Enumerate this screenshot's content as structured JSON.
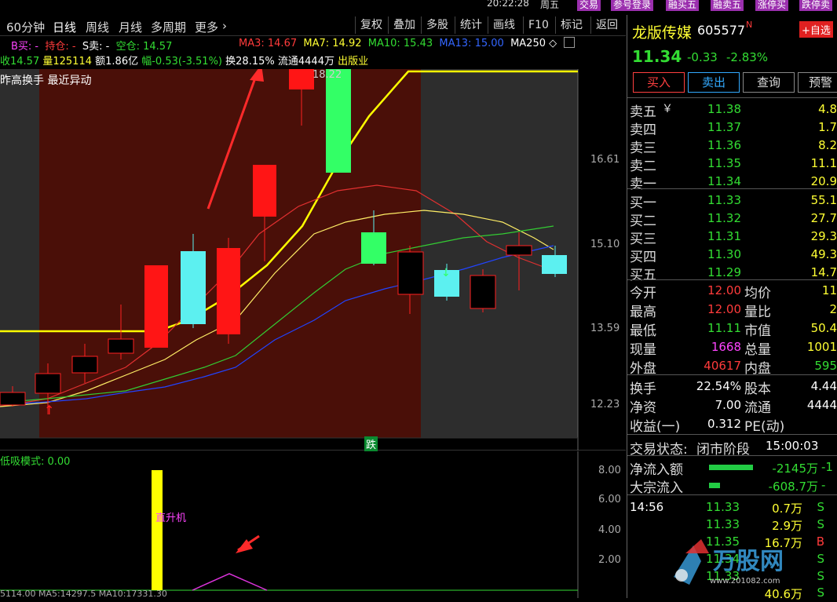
{
  "topbar": {
    "time": "20:22:28",
    "weekday": "周五",
    "buttons": [
      "交易",
      "参号登录",
      "融买五",
      "融卖五",
      "涨停买",
      "跌停卖"
    ]
  },
  "toolbar": {
    "tabs": [
      "60分钟",
      "日线",
      "周线",
      "月线",
      "多周期",
      "更多"
    ],
    "active_tab": "日线",
    "right_buttons": [
      "复权",
      "叠加",
      "多股",
      "统计",
      "画线",
      "F10",
      "标记",
      "返回"
    ]
  },
  "info1": {
    "b_buy": "B买: -",
    "position": "持仓: -",
    "s_sell": "S卖: -",
    "empty_position": "空仓: 14.57",
    "ma3": "MA3: 14.67",
    "ma7": "MA7: 14.92",
    "ma10": "MA10: 15.43",
    "ma13": "MA13: 15.00",
    "ma250": "MA250"
  },
  "info2": {
    "close": "收14.57",
    "volume": "量125114",
    "amount": "额1.86亿",
    "change": "幅-0.53(-3.51%)",
    "turnover": "换28.15%",
    "float": "流通4444万",
    "industry": "出版业"
  },
  "chart_overlay": {
    "notice": "昨高换手 最近异动",
    "high_label": "18.22",
    "drop_badge": "跌"
  },
  "y_axis_main": [
    "16.61",
    "15.10",
    "13.59",
    "12.23"
  ],
  "indicator": {
    "title": "低吸模式: 0.00",
    "bar_label": "直升机",
    "y_axis": [
      "8.00",
      "6.00",
      "4.00",
      "2.00"
    ],
    "bottom_text": "5114.00  MA5:14297.5  MA10:17331.30"
  },
  "stock": {
    "name": "龙版传媒",
    "code": "605577",
    "flag": "N",
    "add_watch": "+自选",
    "price": "11.34",
    "change": "-0.33",
    "change_pct": "-2.83%"
  },
  "actions": [
    "买入",
    "卖出",
    "查询",
    "预警"
  ],
  "sell_orders": [
    {
      "label": "卖五",
      "price": "11.38",
      "vol": "4.8"
    },
    {
      "label": "卖四",
      "price": "11.37",
      "vol": "1.7"
    },
    {
      "label": "卖三",
      "price": "11.36",
      "vol": "8.2"
    },
    {
      "label": "卖二",
      "price": "11.35",
      "vol": "11.1"
    },
    {
      "label": "卖一",
      "price": "11.34",
      "vol": "20.9"
    }
  ],
  "buy_orders": [
    {
      "label": "买一",
      "price": "11.33",
      "vol": "55.1"
    },
    {
      "label": "买二",
      "price": "11.32",
      "vol": "27.7"
    },
    {
      "label": "买三",
      "price": "11.31",
      "vol": "29.3"
    },
    {
      "label": "买四",
      "price": "11.30",
      "vol": "49.3"
    },
    {
      "label": "买五",
      "price": "11.29",
      "vol": "14.7"
    }
  ],
  "quotes": [
    {
      "l1": "今开",
      "v1": "12.00",
      "l2": "均价",
      "v2": "11"
    },
    {
      "l1": "最高",
      "v1": "12.00",
      "l2": "量比",
      "v2": "2"
    },
    {
      "l1": "最低",
      "v1": "11.11",
      "l2": "市值",
      "v2": "50.4"
    },
    {
      "l1": "现量",
      "v1": "1668",
      "l2": "总量",
      "v2": "1001"
    },
    {
      "l1": "外盘",
      "v1": "40617",
      "l2": "内盘",
      "v2": "595"
    }
  ],
  "fundamentals": [
    {
      "l1": "换手",
      "v1": "22.54%",
      "l2": "股本",
      "v2": "4.44"
    },
    {
      "l1": "净资",
      "v1": "7.00",
      "l2": "流通",
      "v2": "4444"
    },
    {
      "l1": "收益(一)",
      "v1": "0.312",
      "l2": "PE(动)",
      "v2": ""
    }
  ],
  "trade_status": {
    "label": "交易状态:",
    "value": "闭市阶段",
    "time": "15:00:03"
  },
  "flows": [
    {
      "label": "净流入额",
      "value": "-2145万",
      "tail": "-1"
    },
    {
      "label": "大宗流入",
      "value": "-608.7万",
      "tail": "-"
    }
  ],
  "ticks": [
    {
      "time": "14:56",
      "price": "11.33",
      "vol": "0.7万",
      "side": "S"
    },
    {
      "time": "",
      "price": "11.33",
      "vol": "2.9万",
      "side": "S"
    },
    {
      "time": "",
      "price": "11.35",
      "vol": "16.7万",
      "side": "B"
    },
    {
      "time": "",
      "price": "11.34",
      "vol": "",
      "side": "S"
    },
    {
      "time": "",
      "price": "11.33",
      "vol": "",
      "side": "S"
    },
    {
      "time": "",
      "price": "",
      "vol": "40.6万",
      "side": "S"
    }
  ],
  "watermark": {
    "brand": "万股网",
    "url": "www.201082.com"
  },
  "colors": {
    "up": "#ff2020",
    "down_fill": "#5cf0f0",
    "bg_zone": "#4a0f08",
    "ma_yellow": "#ffff00"
  }
}
